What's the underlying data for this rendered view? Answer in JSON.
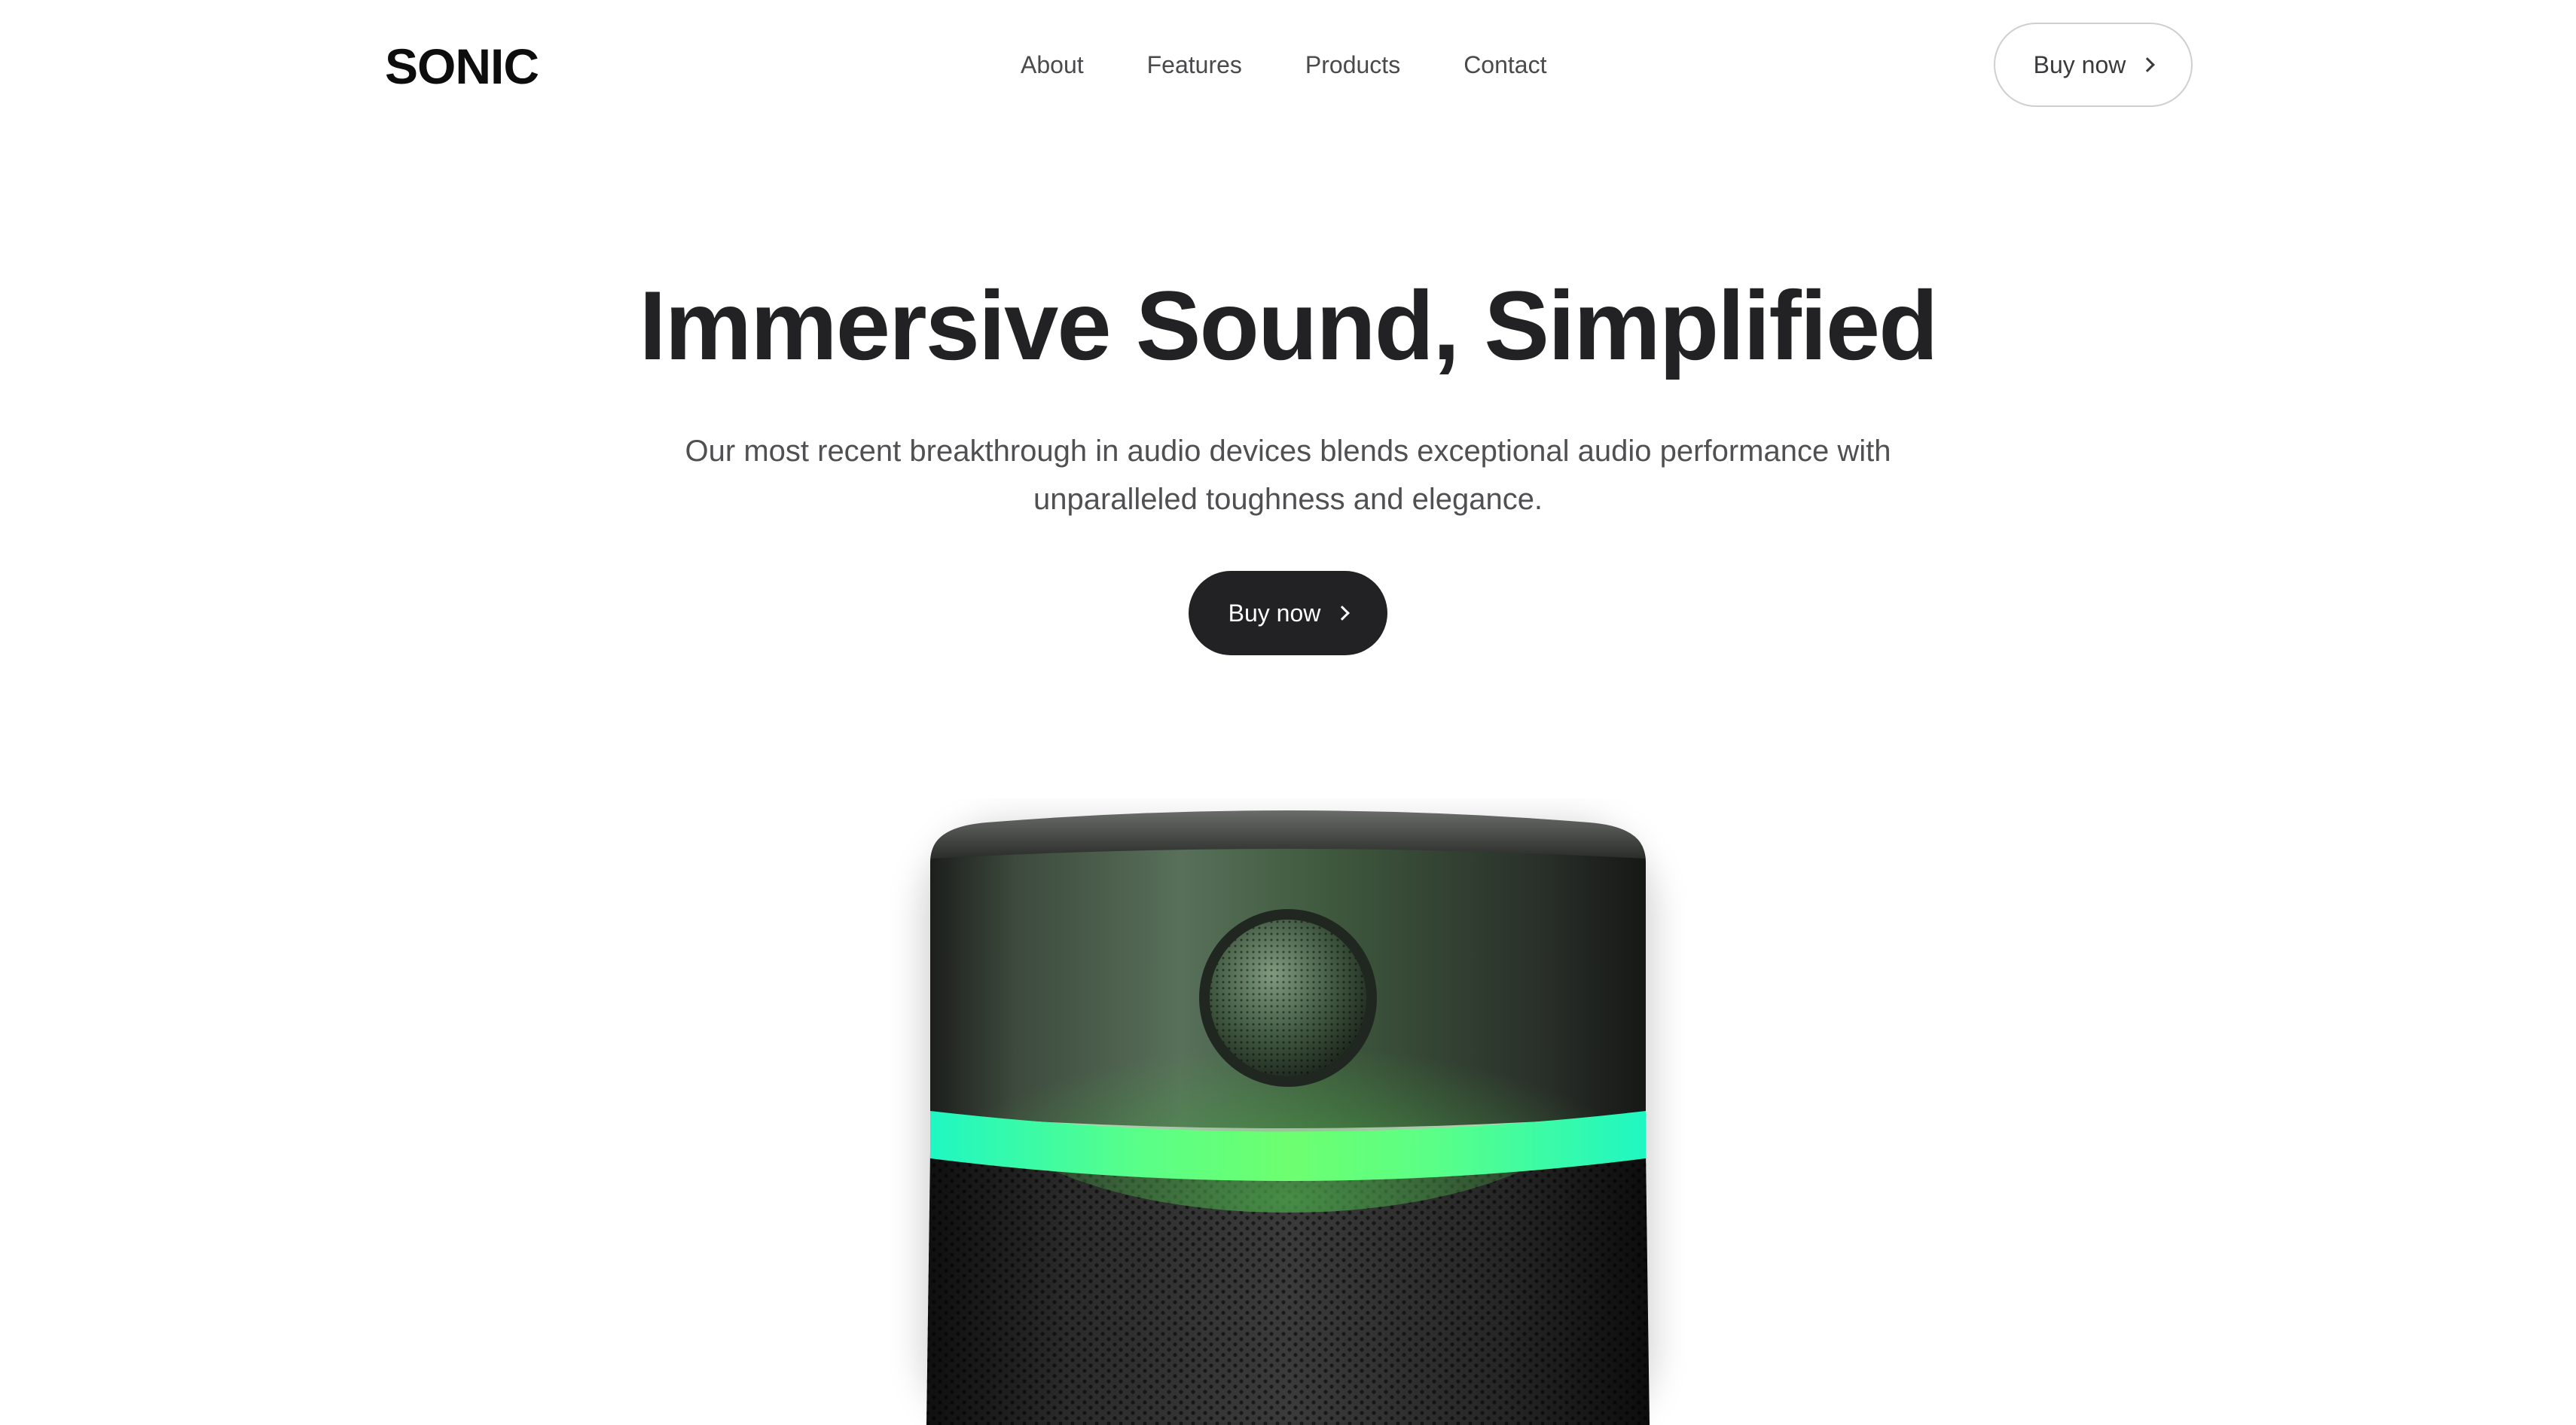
{
  "header": {
    "logo": "SONIC",
    "nav": [
      {
        "label": "About"
      },
      {
        "label": "Features"
      },
      {
        "label": "Products"
      },
      {
        "label": "Contact"
      }
    ],
    "cta_label": "Buy now"
  },
  "hero": {
    "title": "Immersive Sound, Simplified",
    "subtitle": "Our most recent breakthrough in audio devices blends exceptional audio performance with unparalleled toughness and elegance.",
    "cta_label": "Buy now"
  },
  "colors": {
    "primary_dark": "#222224",
    "light_ring_green": "#6dff70",
    "light_ring_teal": "#1ff7c2",
    "background": "#ffffff"
  },
  "icons": {
    "cta_icon": "chevron-right-icon"
  }
}
